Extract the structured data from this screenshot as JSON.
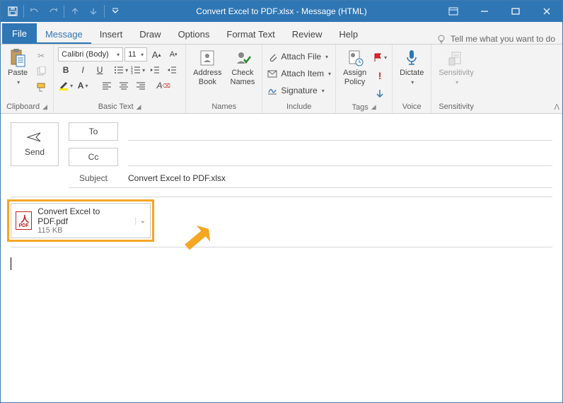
{
  "window": {
    "title": "Convert Excel to PDF.xlsx  -  Message (HTML)"
  },
  "tabs": {
    "file": "File",
    "message": "Message",
    "insert": "Insert",
    "draw": "Draw",
    "options": "Options",
    "format_text": "Format Text",
    "review": "Review",
    "help": "Help",
    "tellme": "Tell me what you want to do"
  },
  "ribbon": {
    "clipboard": {
      "label": "Clipboard",
      "paste": "Paste"
    },
    "basic_text": {
      "label": "Basic Text",
      "font_name": "Calibri (Body)",
      "font_size": "11"
    },
    "names": {
      "label": "Names",
      "address_book": "Address\nBook",
      "check_names": "Check\nNames"
    },
    "include": {
      "label": "Include",
      "attach_file": "Attach File",
      "attach_item": "Attach Item",
      "signature": "Signature"
    },
    "tags": {
      "label": "Tags",
      "assign_policy": "Assign\nPolicy"
    },
    "voice": {
      "label": "Voice",
      "dictate": "Dictate"
    },
    "sensitivity": {
      "label": "Sensitivity",
      "sensitivity_btn": "Sensitivity"
    }
  },
  "compose": {
    "send": "Send",
    "to": "To",
    "cc": "Cc",
    "subject_label": "Subject",
    "subject": "Convert Excel to PDF.xlsx"
  },
  "attachment": {
    "name": "Convert Excel to PDF.pdf",
    "size": "115 KB",
    "icon_label": "PDF"
  }
}
